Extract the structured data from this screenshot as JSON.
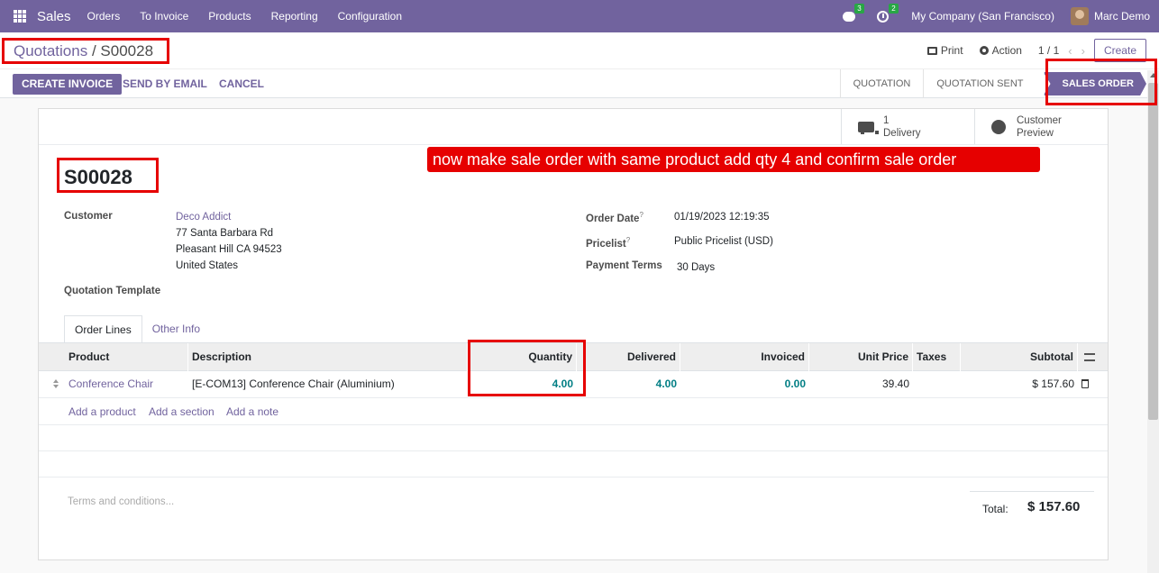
{
  "navbar": {
    "app_name": "Sales",
    "menu": [
      "Orders",
      "To Invoice",
      "Products",
      "Reporting",
      "Configuration"
    ],
    "messages_count": "3",
    "activities_count": "2",
    "company": "My Company (San Francisco)",
    "user": "Marc Demo"
  },
  "breadcrumb": {
    "parent": "Quotations",
    "separator": " / ",
    "current": "S00028"
  },
  "control": {
    "print_label": "Print",
    "action_label": "Action",
    "pager": "1 / 1",
    "prev_icon": "‹",
    "next_icon": "›",
    "create_label": "Create"
  },
  "actions": {
    "create_invoice": "CREATE INVOICE",
    "send_by_email": "SEND BY EMAIL",
    "cancel": "CANCEL"
  },
  "statusbar": {
    "steps": [
      "QUOTATION",
      "QUOTATION SENT",
      "SALES ORDER"
    ],
    "active": "SALES ORDER"
  },
  "smart_buttons": {
    "delivery_count": "1",
    "delivery_label": "Delivery",
    "preview_line1": "Customer",
    "preview_line2": "Preview"
  },
  "order": {
    "name": "S00028",
    "customer_label": "Customer",
    "customer_name": "Deco Addict",
    "address_line1": "77 Santa Barbara Rd",
    "address_line2": "Pleasant Hill CA 94523",
    "address_line3": "United States",
    "template_label": "Quotation Template",
    "order_date_label": "Order Date",
    "order_date": "01/19/2023 12:19:35",
    "pricelist_label": "Pricelist",
    "pricelist": "Public Pricelist (USD)",
    "payment_terms_label": "Payment Terms",
    "payment_terms": "30 Days",
    "help_mark": "?"
  },
  "tabs": [
    "Order Lines",
    "Other Info"
  ],
  "lines": {
    "headers": {
      "product": "Product",
      "description": "Description",
      "quantity": "Quantity",
      "delivered": "Delivered",
      "invoiced": "Invoiced",
      "unit_price": "Unit Price",
      "taxes": "Taxes",
      "subtotal": "Subtotal"
    },
    "rows": [
      {
        "product": "Conference Chair",
        "description": "[E-COM13] Conference Chair (Aluminium)",
        "quantity": "4.00",
        "delivered": "4.00",
        "invoiced": "0.00",
        "unit_price": "39.40",
        "taxes": "",
        "subtotal": "$ 157.60"
      }
    ],
    "add_product": "Add a product",
    "add_section": "Add a section",
    "add_note": "Add a note"
  },
  "footer": {
    "terms_placeholder": "Terms and conditions...",
    "total_label": "Total:",
    "total_value": "$ 157.60"
  },
  "annotation": {
    "note": "now make sale order with same  product add qty 4 and confirm sale order",
    "color": "#e60000"
  },
  "theme": {
    "primary": "#71639e",
    "teal": "#017e84",
    "badge": "#28a745"
  }
}
